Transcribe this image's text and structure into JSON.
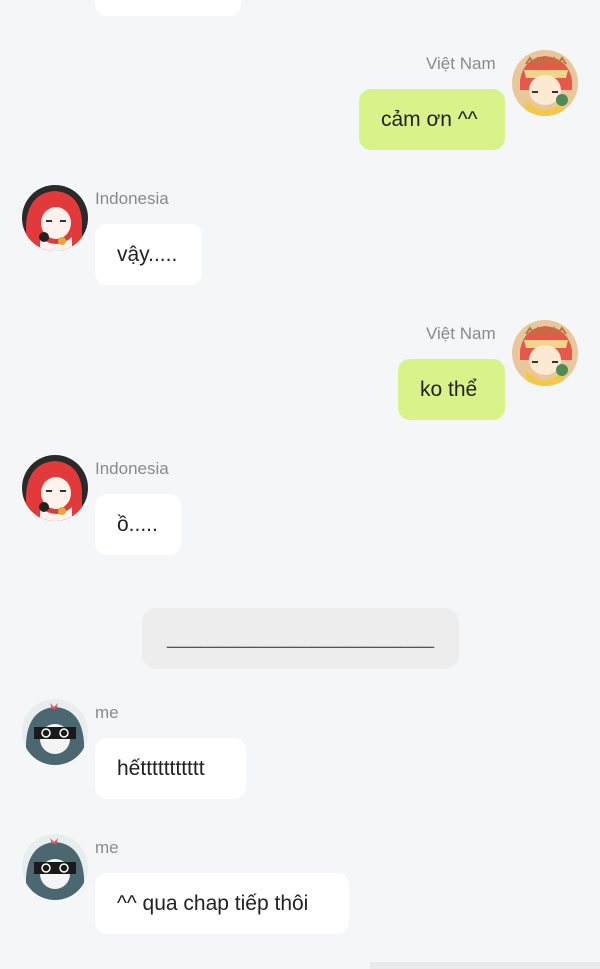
{
  "conversation": {
    "messages": [
      {
        "sender": "Việt Nam",
        "text": "cảm ơn ^^",
        "side": "right",
        "avatar": "vietnam-avatar"
      },
      {
        "sender": "Indonesia",
        "text": "vậy.....",
        "side": "left",
        "avatar": "indonesia-avatar"
      },
      {
        "sender": "Việt Nam",
        "text": "ko thể",
        "side": "right",
        "avatar": "vietnam-avatar"
      },
      {
        "sender": "Indonesia",
        "text": "ồ.....",
        "side": "left",
        "avatar": "indonesia-avatar"
      },
      {
        "sender": "me",
        "text": "hếttttttttttt",
        "side": "left",
        "avatar": "me-avatar"
      },
      {
        "sender": "me",
        "text": "^^ qua chap tiếp thôi",
        "side": "left",
        "avatar": "me-avatar"
      }
    ],
    "divider_text": "________________________"
  },
  "colors": {
    "background": "#f5f6f8",
    "incoming_bubble": "#ffffff",
    "outgoing_bubble": "#d9f38a",
    "divider_bubble": "#ededed",
    "sender_name": "#8a8a8a"
  }
}
